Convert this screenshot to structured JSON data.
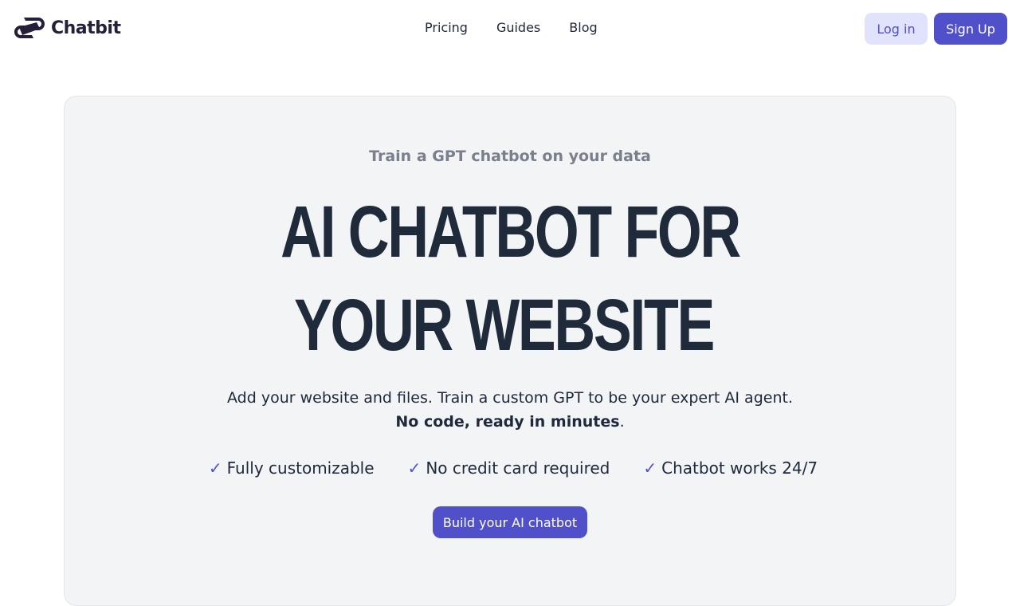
{
  "brand": {
    "name": "Chatbit",
    "logo_icon": "chatbit-logo-icon",
    "logo_color": "#251f3a"
  },
  "nav": {
    "items": [
      {
        "label": "Pricing"
      },
      {
        "label": "Guides"
      },
      {
        "label": "Blog"
      }
    ]
  },
  "auth": {
    "login_label": "Log in",
    "signup_label": "Sign Up"
  },
  "hero": {
    "eyebrow": "Train a GPT chatbot on your data",
    "headline_line1": "AI CHATBOT FOR",
    "headline_line2": "YOUR WEBSITE",
    "description": "Add your website and files. Train a custom GPT to be your expert AI agent.",
    "description_strong": "No code, ready in minutes",
    "description_tail": ".",
    "features": [
      {
        "icon": "checkmark-icon",
        "label": "Fully customizable"
      },
      {
        "icon": "checkmark-icon",
        "label": "No credit card required"
      },
      {
        "icon": "checkmark-icon",
        "label": "Chatbot works 24/7"
      }
    ],
    "cta_label": "Build your AI chatbot"
  },
  "colors": {
    "accent": "#5051ca",
    "accent_light": "#e0e3fb",
    "hero_bg": "#f2f4f5",
    "heading": "#1f2a3b",
    "muted": "#7a7f8c"
  }
}
